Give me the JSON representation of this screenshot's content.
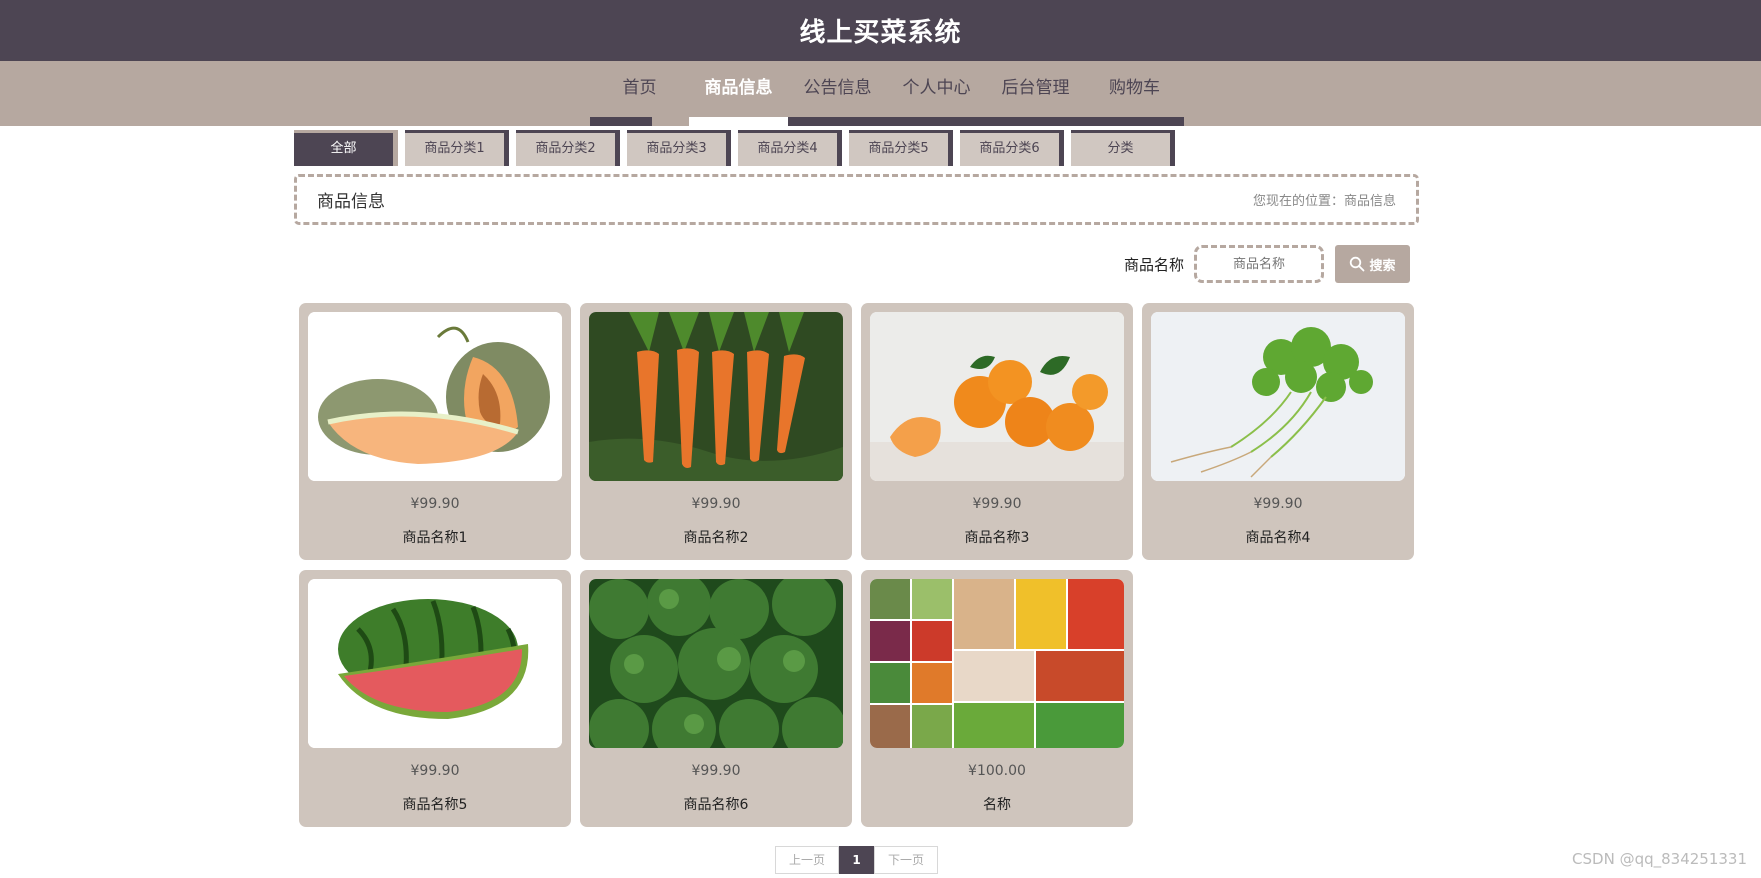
{
  "header": {
    "title": "线上买菜系统"
  },
  "nav": {
    "items": [
      {
        "label": "首页",
        "active": false
      },
      {
        "label": "商品信息",
        "active": true
      },
      {
        "label": "公告信息",
        "active": false
      },
      {
        "label": "个人中心",
        "active": false
      },
      {
        "label": "后台管理",
        "active": false
      },
      {
        "label": "购物车",
        "active": false
      }
    ]
  },
  "categories": [
    {
      "label": "全部",
      "active": true
    },
    {
      "label": "商品分类1",
      "active": false
    },
    {
      "label": "商品分类2",
      "active": false
    },
    {
      "label": "商品分类3",
      "active": false
    },
    {
      "label": "商品分类4",
      "active": false
    },
    {
      "label": "商品分类5",
      "active": false
    },
    {
      "label": "商品分类6",
      "active": false
    },
    {
      "label": "分类",
      "active": false
    }
  ],
  "breadcrumb": {
    "section": "商品信息",
    "location": "您现在的位置：商品信息"
  },
  "search": {
    "label": "商品名称",
    "placeholder": "商品名称",
    "button": "搜索"
  },
  "products": [
    {
      "name": "商品名称1",
      "price": "¥99.90",
      "image": "cantaloupe"
    },
    {
      "name": "商品名称2",
      "price": "¥99.90",
      "image": "carrots"
    },
    {
      "name": "商品名称3",
      "price": "¥99.90",
      "image": "oranges"
    },
    {
      "name": "商品名称4",
      "price": "¥99.90",
      "image": "cilantro"
    },
    {
      "name": "商品名称5",
      "price": "¥99.90",
      "image": "watermelon"
    },
    {
      "name": "商品名称6",
      "price": "¥99.90",
      "image": "broccoli"
    },
    {
      "name": "名称",
      "price": "¥100.00",
      "image": "vegetable-collage"
    }
  ],
  "pagination": {
    "prev": "上一页",
    "current": "1",
    "next": "下一页"
  },
  "watermark": "CSDN @qq_834251331",
  "colors": {
    "header": "#4d4553",
    "nav": "#b6a8a0",
    "card": "#cfc5bd"
  }
}
